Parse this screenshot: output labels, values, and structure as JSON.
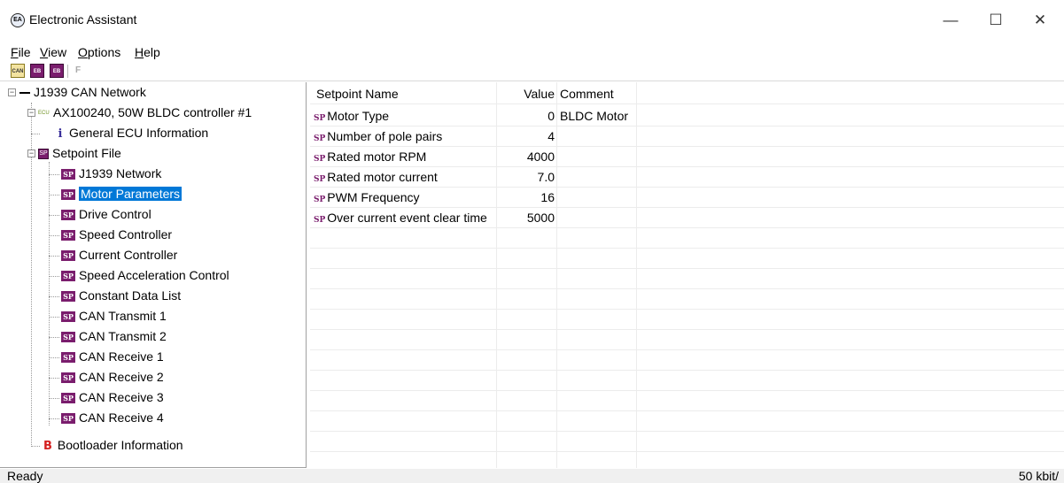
{
  "window": {
    "title": "Electronic Assistant",
    "icon_text": "EA",
    "minimize": "—",
    "maximize": "☐",
    "close": "✕"
  },
  "menu": {
    "file": {
      "accel": "F",
      "rest": "ile"
    },
    "view": {
      "accel": "V",
      "rest": "iew"
    },
    "options": {
      "accel": "O",
      "rest": "ptions"
    },
    "help": {
      "accel": "H",
      "rest": "elp"
    }
  },
  "toolbar": {
    "btn1": "CAN",
    "btn2": "EB",
    "btn3": "EB",
    "btn4": "F"
  },
  "tree": {
    "network": "J1939 CAN Network",
    "controller": "AX100240, 50W BLDC controller #1",
    "ecu_tag": "ECU",
    "general": "General ECU Information",
    "info_glyph": "i",
    "setpoint_file": "Setpoint File",
    "sp_glyph": "SP",
    "items": [
      "J1939 Network",
      "Motor Parameters",
      "Drive Control",
      "Speed Controller",
      "Current Controller",
      "Speed Acceleration Control",
      "Constant Data List",
      "CAN Transmit 1",
      "CAN Transmit 2",
      "CAN Receive 1",
      "CAN Receive 2",
      "CAN Receive 3",
      "CAN Receive 4"
    ],
    "selected_index": 1,
    "bootloader": "Bootloader Information",
    "boot_glyph": "B",
    "minus": "−"
  },
  "grid": {
    "headers": {
      "name": "Setpoint Name",
      "value": "Value",
      "comment": "Comment"
    },
    "rows": [
      {
        "name": "Motor Type",
        "value": "0",
        "comment": "BLDC Motor"
      },
      {
        "name": "Number of pole pairs",
        "value": "4",
        "comment": ""
      },
      {
        "name": "Rated motor RPM",
        "value": "4000",
        "comment": ""
      },
      {
        "name": "Rated motor current",
        "value": "7.0",
        "comment": ""
      },
      {
        "name": "PWM Frequency",
        "value": "16",
        "comment": ""
      },
      {
        "name": "Over current event clear time",
        "value": "5000",
        "comment": ""
      }
    ]
  },
  "status": {
    "left": "Ready",
    "right": "50 kbit/"
  }
}
